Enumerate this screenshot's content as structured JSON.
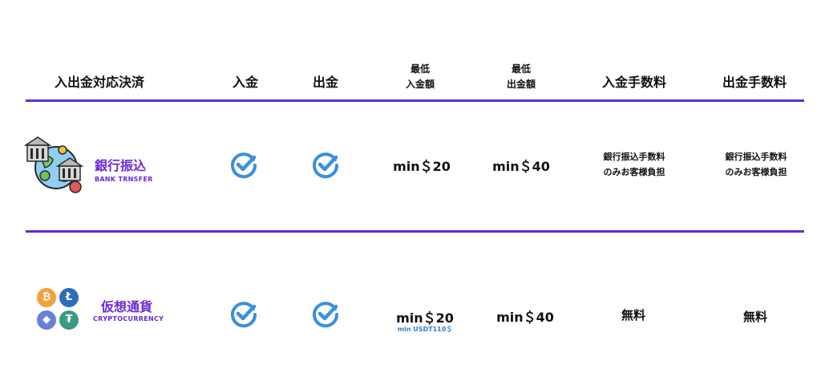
{
  "header": {
    "method": "入出金対応決済",
    "deposit": "入金",
    "withdraw": "出金",
    "min_deposit_l1": "最低",
    "min_deposit_l2": "入金額",
    "min_withdraw_l1": "最低",
    "min_withdraw_l2": "出金額",
    "deposit_fee": "入金手数料",
    "withdraw_fee": "出金手数料"
  },
  "rows": [
    {
      "name": "銀行振込",
      "sub": "BANK TRNSFER",
      "icon": "bank-transfer-globe-icon",
      "min_deposit": "min＄20",
      "min_withdraw": "min＄40",
      "deposit_fee_l1": "銀行振込手数料",
      "deposit_fee_l2": "のみお客様負担",
      "withdraw_fee_l1": "銀行振込手数料",
      "withdraw_fee_l2": "のみお客様負担"
    },
    {
      "name": "仮想通貨",
      "sub": "CRYPTOCURRENCY",
      "icon": "crypto-coins-icon",
      "min_deposit": "min＄20",
      "min_deposit_sub": "min USDT110＄",
      "min_withdraw": "min＄40",
      "deposit_fee": "無料",
      "withdraw_fee": "無料"
    }
  ],
  "colors": {
    "accent": "#5a2fd6",
    "method_text": "#6a2ad8",
    "check": "#3a8fe0",
    "sub_note": "#2f7fcf",
    "btc": "#f2a23a",
    "ltc": "#2e6cc0",
    "eth": "#6a7fd8",
    "usdt": "#3a9a82"
  },
  "coins": [
    "bitcoin-icon",
    "litecoin-icon",
    "ethereum-icon",
    "tether-icon"
  ]
}
